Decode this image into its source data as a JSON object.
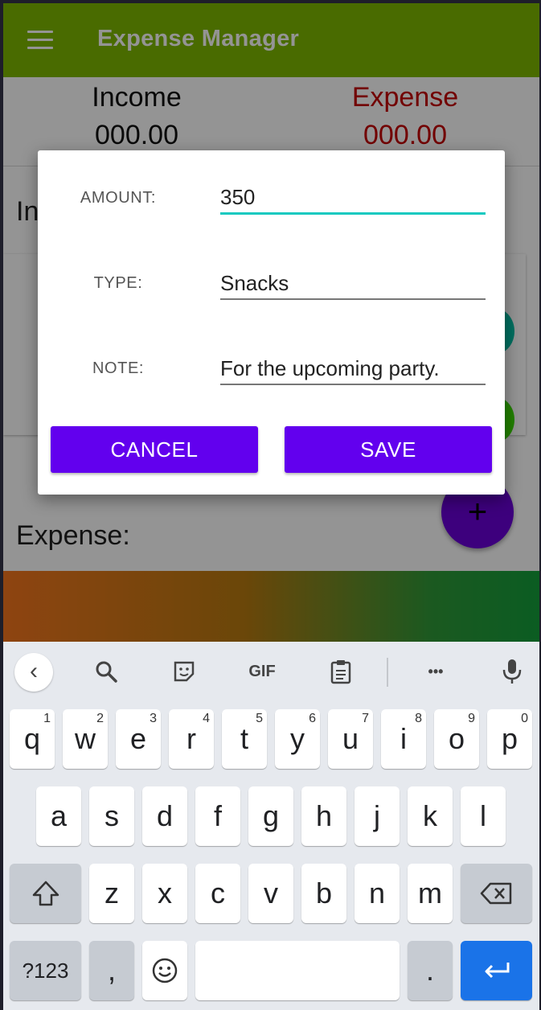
{
  "app": {
    "title": "Expense Manager",
    "income_label": "Income",
    "income_value": "000.00",
    "expense_label": "Expense",
    "expense_value": "000.00",
    "income_heading": "In",
    "expense_heading": "Expense:",
    "fab_label": "+"
  },
  "dialog": {
    "amount_label": "AMOUNT:",
    "amount_value": "350",
    "type_label": "TYPE:",
    "type_value": "Snacks",
    "note_label": "NOTE:",
    "note_value": "For the upcoming party.",
    "cancel_label": "CANCEL",
    "save_label": "SAVE"
  },
  "keyboard": {
    "toolbar": {
      "back_icon": "chevron-left-icon",
      "search_icon": "search-icon",
      "sticker_icon": "sticker-icon",
      "gif_label": "GIF",
      "clipboard_icon": "clipboard-icon",
      "more_label": "•••",
      "mic_icon": "mic-icon"
    },
    "row1": [
      {
        "key": "q",
        "num": "1"
      },
      {
        "key": "w",
        "num": "2"
      },
      {
        "key": "e",
        "num": "3"
      },
      {
        "key": "r",
        "num": "4"
      },
      {
        "key": "t",
        "num": "5"
      },
      {
        "key": "y",
        "num": "6"
      },
      {
        "key": "u",
        "num": "7"
      },
      {
        "key": "i",
        "num": "8"
      },
      {
        "key": "o",
        "num": "9"
      },
      {
        "key": "p",
        "num": "0"
      }
    ],
    "row2": [
      "a",
      "s",
      "d",
      "f",
      "g",
      "h",
      "j",
      "k",
      "l"
    ],
    "row3": [
      "z",
      "x",
      "c",
      "v",
      "b",
      "n",
      "m"
    ],
    "symbols_label": "?123",
    "comma_label": ",",
    "period_label": ".",
    "colors": {
      "enter": "#1a73e8",
      "accent": "#6200ee",
      "appbar": "#7fb800"
    }
  }
}
